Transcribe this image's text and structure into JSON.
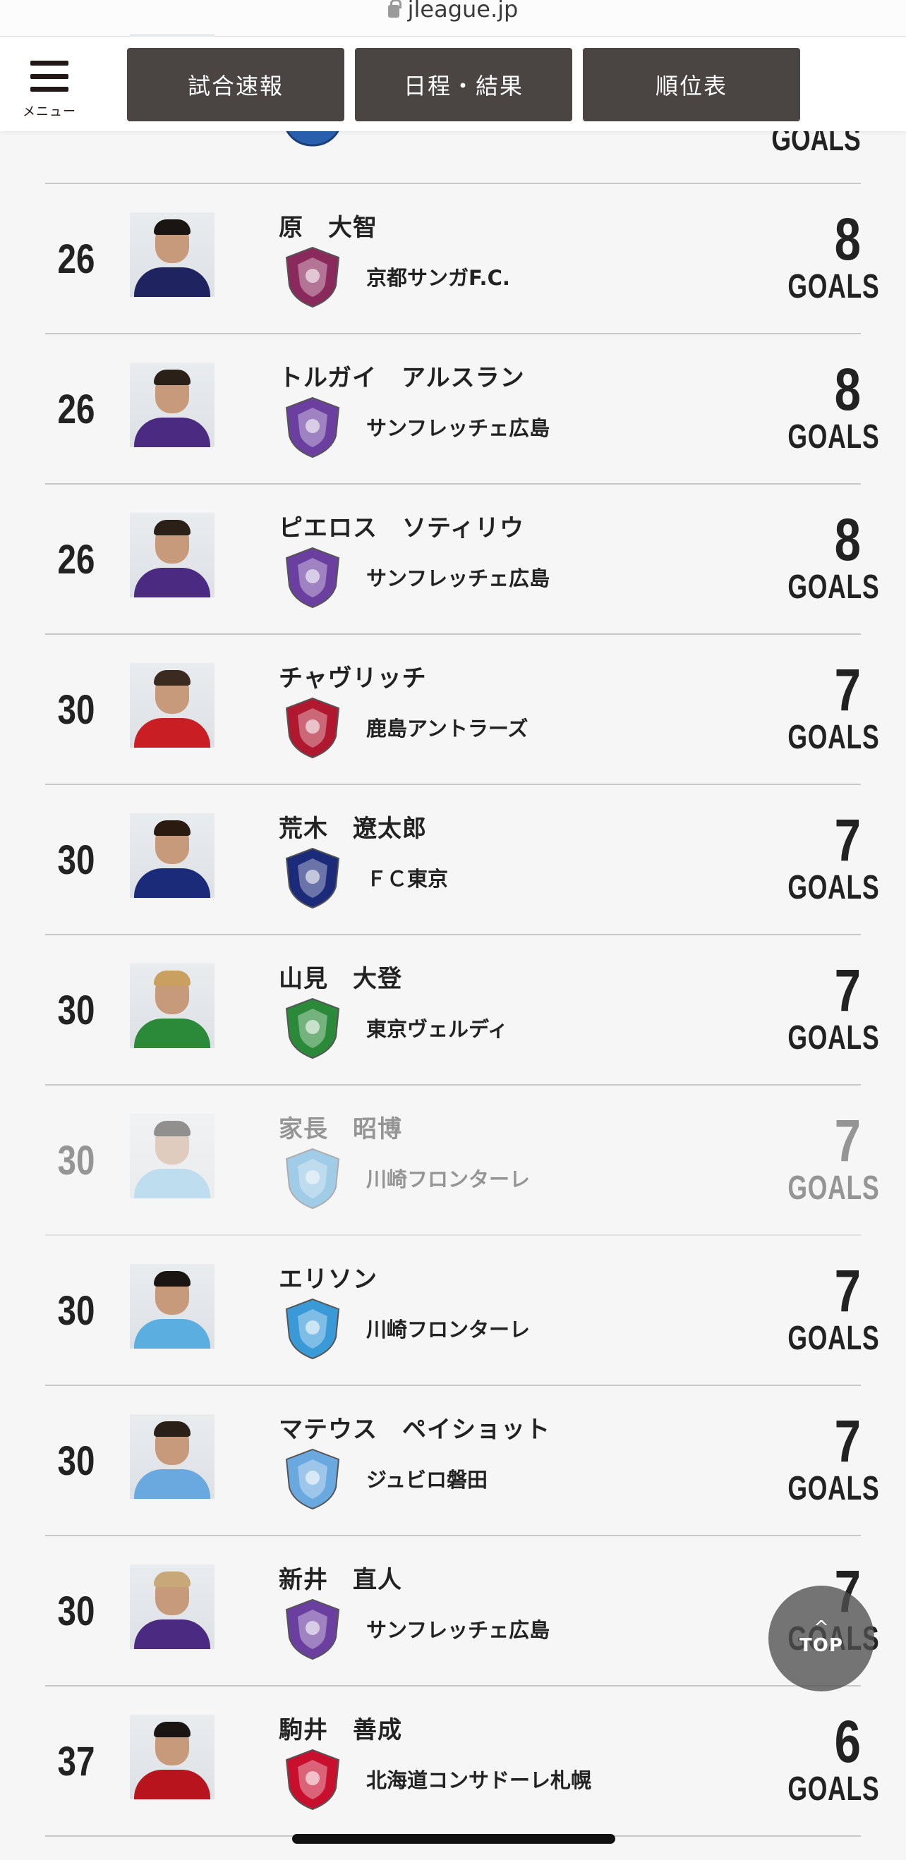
{
  "browser": {
    "url": "jleague.jp"
  },
  "header": {
    "menu_label": "メニュー",
    "nav": [
      "試合速報",
      "日程・結果",
      "順位表"
    ]
  },
  "partial_row": {
    "goals_unit": "GOALS"
  },
  "rows": [
    {
      "rank": "26",
      "name": "原　大智",
      "team": "京都サンガF.C.",
      "goals": "8",
      "unit": "GOALS"
    },
    {
      "rank": "26",
      "name": "トルガイ　アルスラン",
      "team": "サンフレッチェ広島",
      "goals": "8",
      "unit": "GOALS"
    },
    {
      "rank": "26",
      "name": "ピエロス　ソティリウ",
      "team": "サンフレッチェ広島",
      "goals": "8",
      "unit": "GOALS"
    },
    {
      "rank": "30",
      "name": "チャヴリッチ",
      "team": "鹿島アントラーズ",
      "goals": "7",
      "unit": "GOALS"
    },
    {
      "rank": "30",
      "name": "荒木　遼太郎",
      "team": "ＦＣ東京",
      "goals": "7",
      "unit": "GOALS"
    },
    {
      "rank": "30",
      "name": "山見　大登",
      "team": "東京ヴェルディ",
      "goals": "7",
      "unit": "GOALS"
    },
    {
      "rank": "30",
      "name": "家長　昭博",
      "team": "川崎フロンターレ",
      "goals": "7",
      "unit": "GOALS"
    },
    {
      "rank": "30",
      "name": "エリソン",
      "team": "川崎フロンターレ",
      "goals": "7",
      "unit": "GOALS"
    },
    {
      "rank": "30",
      "name": "マテウス　ペイショット",
      "team": "ジュビロ磐田",
      "goals": "7",
      "unit": "GOALS"
    },
    {
      "rank": "30",
      "name": "新井　直人",
      "team": "サンフレッチェ広島",
      "goals": "7",
      "unit": "GOALS"
    },
    {
      "rank": "37",
      "name": "駒井　善成",
      "team": "北海道コンサドーレ札幌",
      "goals": "6",
      "unit": "GOALS"
    }
  ],
  "emblem_colors": {
    "kyoto": "#8a2a5c",
    "hiroshima": "#6b3fa0",
    "kashima": "#b01830",
    "fctokyo": "#1c2a7a",
    "verdy": "#2a8a3a",
    "kawasaki": "#3a9ad8",
    "iwata": "#6aa8e0",
    "sapporo": "#c8102e"
  },
  "top_button": {
    "label": "TOP",
    "chevron": "^"
  }
}
